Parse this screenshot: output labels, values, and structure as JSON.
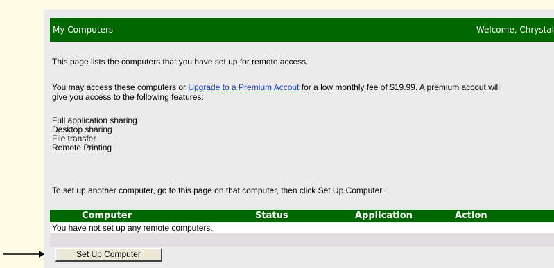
{
  "header": {
    "title": "My Computers",
    "welcome": "Welcome, Chrystal"
  },
  "content": {
    "intro": "This page lists the computers that you have set up for remote access.",
    "access_before": "You may access these computers or ",
    "upgrade_link": "Upgrade to a Premium Accout",
    "access_after": " for a low monthly fee of $19.99. A premium accout will",
    "access_line2": "give you access to the following features:",
    "features": [
      "Full application sharing",
      "Desktop sharing",
      "File transfer",
      "Remote Printing"
    ],
    "setup_instructions": "To set up another computer, go to this page on that computer, then click Set Up Computer."
  },
  "table": {
    "columns": [
      "Computer",
      "Status",
      "Application",
      "Action"
    ],
    "empty_message": "You have not set up any remote computers."
  },
  "actions": {
    "setup_button": "Set Up Computer"
  },
  "colors": {
    "header_green": "#006600",
    "panel_gray": "#ebebeb",
    "link_blue": "#1a3fc8",
    "page_cream": "#fffbe6"
  }
}
